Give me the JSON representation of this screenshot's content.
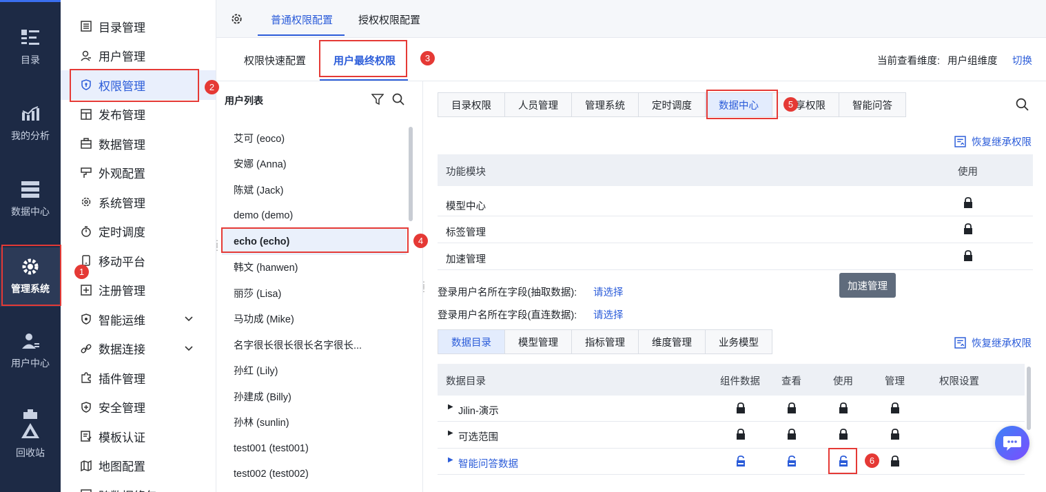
{
  "rail": [
    {
      "label": "目录",
      "icon": "catalog-icon"
    },
    {
      "label": "我的分析",
      "icon": "analysis-icon"
    },
    {
      "label": "数据中心",
      "icon": "datacenter-icon"
    },
    {
      "label": "管理系统",
      "icon": "gear-icon",
      "active": true
    },
    {
      "label": "用户中心",
      "icon": "user-icon"
    },
    {
      "label": "回收站",
      "icon": "recycle-icon"
    }
  ],
  "menu": [
    {
      "label": "目录管理"
    },
    {
      "label": "用户管理"
    },
    {
      "label": "权限管理",
      "active": true
    },
    {
      "label": "发布管理"
    },
    {
      "label": "数据管理"
    },
    {
      "label": "外观配置"
    },
    {
      "label": "系统管理"
    },
    {
      "label": "定时调度"
    },
    {
      "label": "移动平台"
    },
    {
      "label": "注册管理"
    },
    {
      "label": "智能运维"
    },
    {
      "label": "数据连接"
    },
    {
      "label": "插件管理"
    },
    {
      "label": "安全管理"
    },
    {
      "label": "模板认证"
    },
    {
      "label": "地图配置"
    },
    {
      "label": "跨数据络包"
    }
  ],
  "toptabs": [
    "普通权限配置",
    "授权权限配置"
  ],
  "subtabs": [
    "权限快速配置",
    "用户最终权限"
  ],
  "view": {
    "label": "当前查看维度:",
    "value": "用户组维度",
    "switch": "切换"
  },
  "userlist": {
    "title": "用户列表",
    "users": [
      "艾可 (eoco)",
      "安娜 (Anna)",
      "陈斌 (Jack)",
      "demo (demo)",
      "echo (echo)",
      "韩文 (hanwen)",
      "丽莎 (Lisa)",
      "马功成 (Mike)",
      "名字很长很长很长名字很长...",
      "孙红 (Lily)",
      "孙建成 (Billy)",
      "孙林 (sunlin)",
      "test001 (test001)",
      "test002 (test002)"
    ]
  },
  "perm_tabs": [
    "目录权限",
    "人员管理",
    "管理系统",
    "定时调度",
    "数据中心",
    "分享权限",
    "智能问答"
  ],
  "restore_label": "恢复继承权限",
  "module_table": {
    "headers": [
      "功能模块",
      "使用"
    ],
    "rows": [
      "模型中心",
      "标签管理",
      "加速管理"
    ]
  },
  "fields": [
    {
      "label": "登录用户名所在字段(抽取数据):",
      "link": "请选择"
    },
    {
      "label": "登录用户名所在字段(直连数据):",
      "link": "请选择"
    }
  ],
  "tooltip": "加速管理",
  "data_tabs": [
    "数据目录",
    "模型管理",
    "指标管理",
    "维度管理",
    "业务模型"
  ],
  "data_table": {
    "headers": [
      "数据目录",
      "组件数据",
      "查看",
      "使用",
      "管理",
      "权限设置"
    ],
    "rows": [
      {
        "name": "Jilin-演示",
        "locked": [
          true,
          true,
          true,
          true
        ]
      },
      {
        "name": "可选范围",
        "locked": [
          true,
          true,
          true,
          true
        ]
      },
      {
        "name": "智能问答数据",
        "locked": [
          false,
          false,
          false,
          true
        ]
      }
    ]
  },
  "badges": [
    "1",
    "2",
    "3",
    "4",
    "5",
    "6"
  ],
  "colors": {
    "accent": "#2b5cd9",
    "rail": "#1d2a45",
    "highlight": "#e53935"
  }
}
